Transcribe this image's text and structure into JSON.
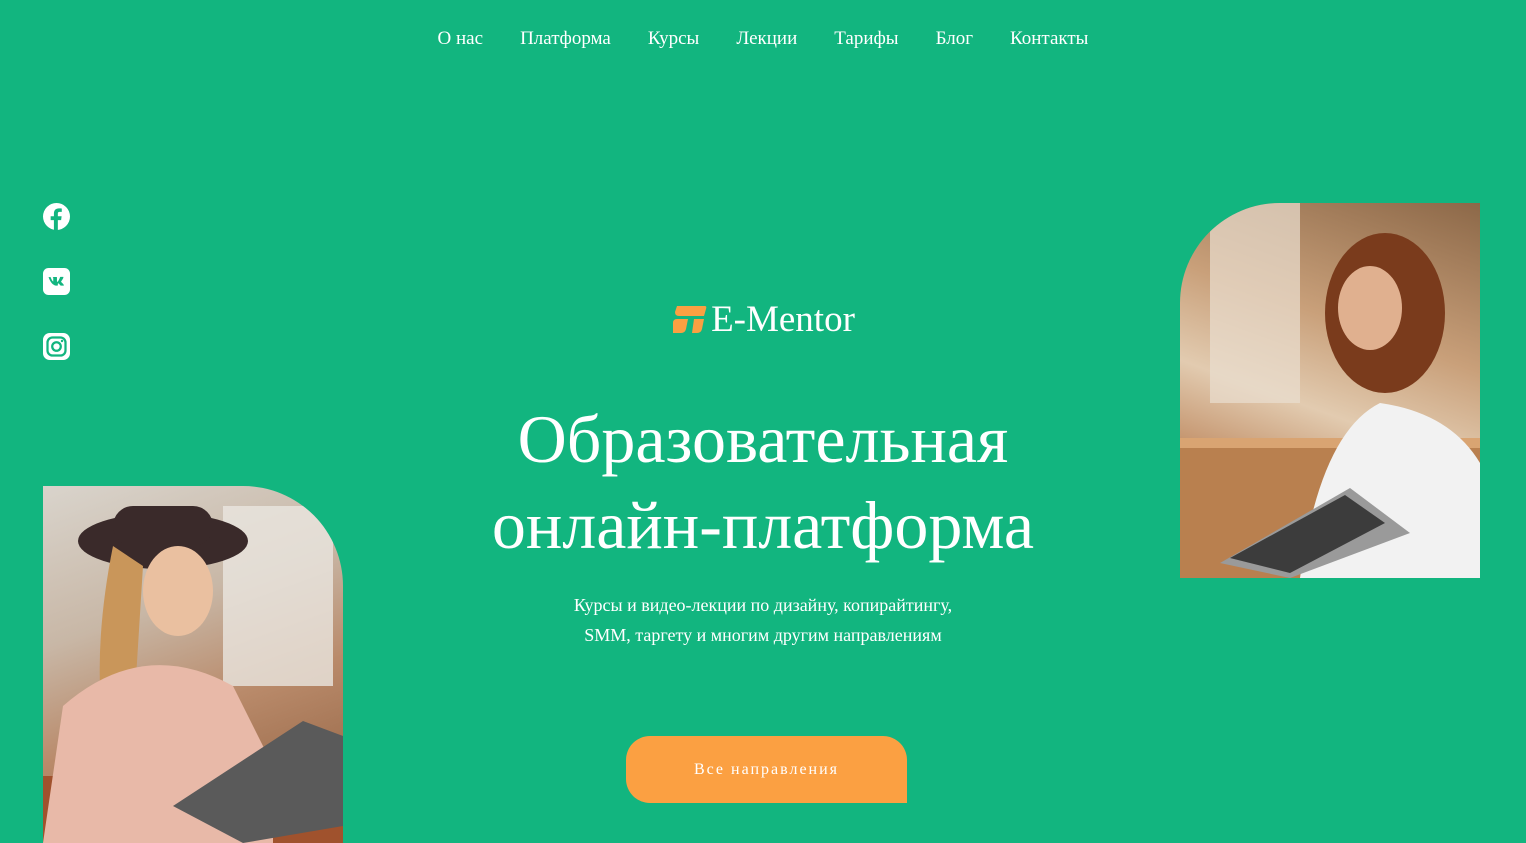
{
  "nav": {
    "items": [
      {
        "label": "О нас"
      },
      {
        "label": "Платформа"
      },
      {
        "label": "Курсы"
      },
      {
        "label": "Лекции"
      },
      {
        "label": "Тарифы"
      },
      {
        "label": "Блог"
      },
      {
        "label": "Контакты"
      }
    ]
  },
  "social": {
    "icons": [
      "facebook-icon",
      "vk-icon",
      "instagram-icon"
    ]
  },
  "brand": {
    "name": "E-Mentor",
    "icon": "logo-icon",
    "icon_color": "#fba042"
  },
  "hero": {
    "title_line1": "Образовательная",
    "title_line2": "онлайн-платформа",
    "subtitle_line1": "Курсы и видео-лекции по дизайну, копирайтингу,",
    "subtitle_line2": "SMM, таргету и многим другим направлениям",
    "cta_label": "Все направления"
  },
  "colors": {
    "background": "#12b57f",
    "accent": "#fba042",
    "text": "#ffffff"
  }
}
